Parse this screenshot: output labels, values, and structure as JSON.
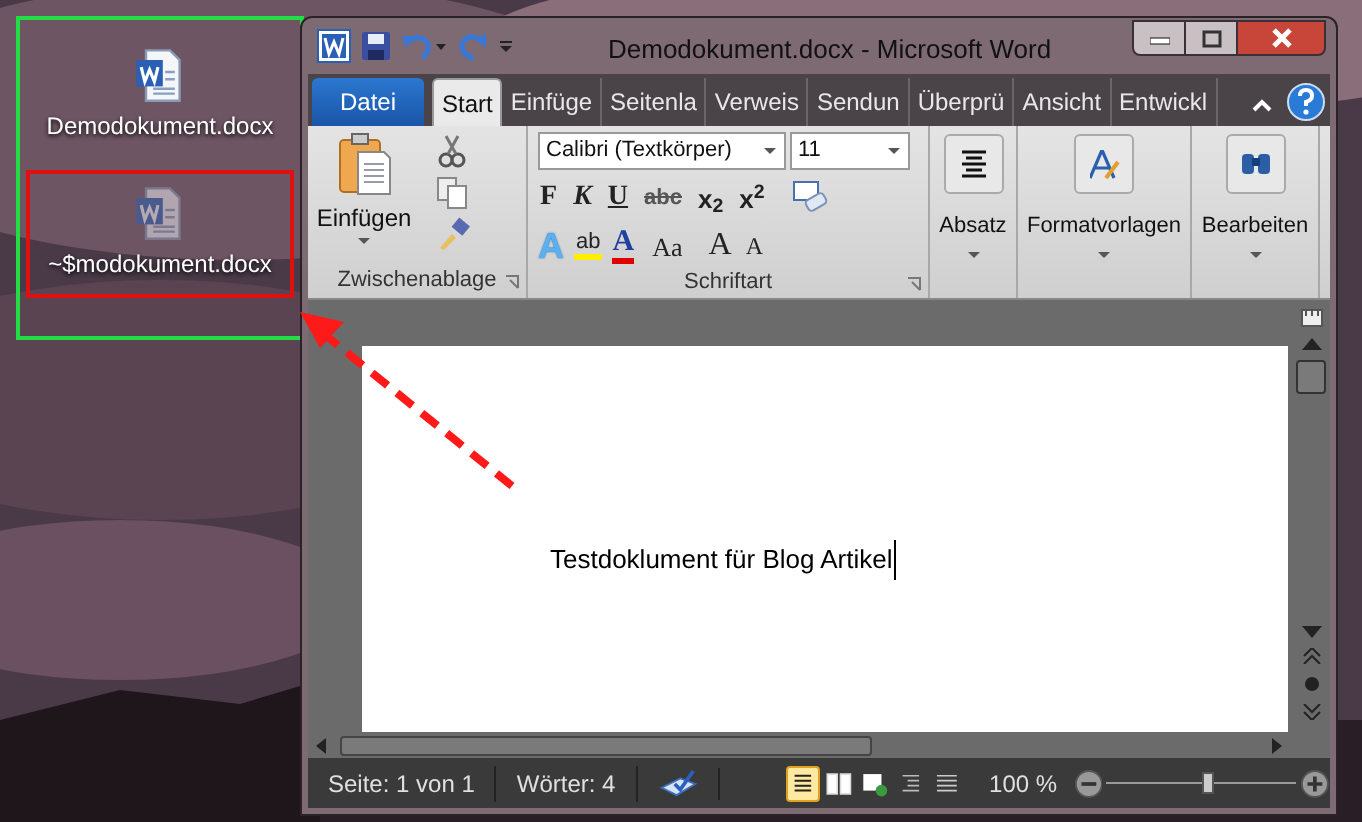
{
  "desktop": {
    "icons": [
      {
        "label": "Demodokument.docx",
        "hidden": false
      },
      {
        "label": "~$modokument.docx",
        "hidden": true
      }
    ]
  },
  "window": {
    "title": "Demodokument.docx  -  Microsoft Word"
  },
  "ribbon": {
    "file_tab": "Datei",
    "tabs": [
      {
        "label": "Start",
        "selected": true
      },
      {
        "label": "Einfüge",
        "selected": false
      },
      {
        "label": "Seitenla",
        "selected": false
      },
      {
        "label": "Verweis",
        "selected": false
      },
      {
        "label": "Sendun",
        "selected": false
      },
      {
        "label": "Überprü",
        "selected": false
      },
      {
        "label": "Ansicht",
        "selected": false
      },
      {
        "label": "Entwickl",
        "selected": false
      }
    ],
    "clipboard": {
      "label": "Zwischenablage",
      "paste": "Einfügen"
    },
    "font": {
      "label": "Schriftart",
      "font_name": "Calibri (Textkörper)",
      "font_size": "11",
      "row1": [
        {
          "kind": "bold",
          "text": "F"
        },
        {
          "kind": "italic",
          "text": "K"
        },
        {
          "kind": "underline",
          "text": "U"
        },
        {
          "kind": "strike",
          "text": "abc"
        },
        {
          "kind": "script",
          "text": "x$_{2}$"
        },
        {
          "kind": "script",
          "text": "x$^{2}$"
        }
      ],
      "row2": [
        {
          "kind": "effect",
          "text": "A"
        },
        {
          "kind": "highlight",
          "text": "ab"
        },
        {
          "kind": "color",
          "text": "A"
        },
        {
          "kind": "case",
          "text": "Aa"
        },
        {
          "kind": "grow",
          "text": "A"
        },
        {
          "kind": "shrink",
          "text": "A"
        }
      ]
    },
    "groups": [
      {
        "kind": "paragraph",
        "label": "Absatz"
      },
      {
        "kind": "styles",
        "label": "Formatvorlagen"
      },
      {
        "kind": "editing",
        "label": "Bearbeiten"
      }
    ]
  },
  "document": {
    "text": "Testdoklument für Blog Artikel"
  },
  "status_bar": {
    "page": "Seite: 1 von 1",
    "words": "Wörter: 4",
    "views": [
      {
        "selected": true
      },
      {
        "selected": false
      },
      {
        "selected": false
      },
      {
        "selected": false
      },
      {
        "selected": false
      }
    ],
    "zoom": "100 %",
    "zoom_slider": {
      "level": 0.5
    }
  }
}
